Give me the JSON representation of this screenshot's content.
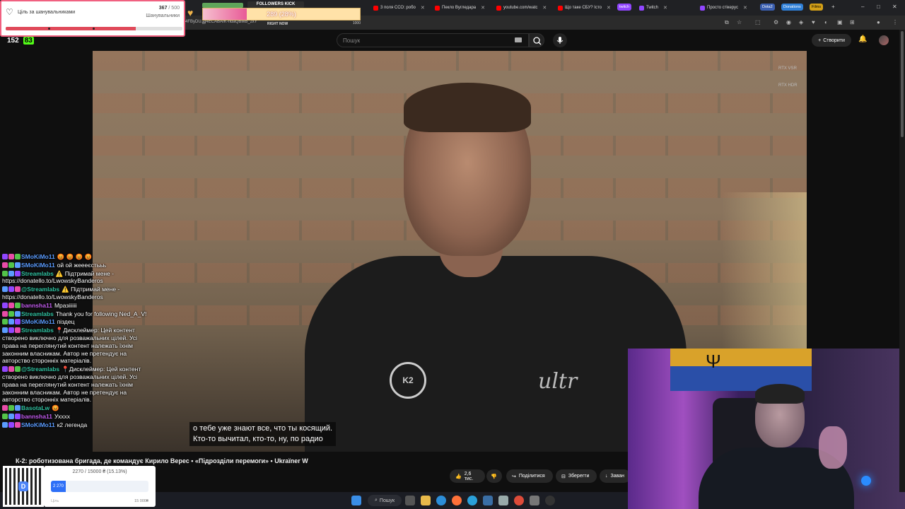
{
  "browser": {
    "tabs": [
      {
        "label": "3 поля ССО: робо"
      },
      {
        "label": "Пекло Вугледара"
      },
      {
        "label": "youtube.com/watc"
      },
      {
        "label": "Що таке СБУ? Істо"
      },
      {
        "label": "Twitch"
      },
      {
        "label": "Просто стікерус"
      }
    ],
    "chips": [
      "twitch",
      "Dota2",
      "Donations",
      "Films"
    ],
    "url": "4FByDU..g4ECABAIK-ndaQBMB_zxY"
  },
  "youtube": {
    "search_placeholder": "Пошук",
    "create_label": "Створити",
    "video_title": "К-2: роботизована бригада, де командує Кирило Верес • «Підрозділи перемоги» • Ukraїner W",
    "subtitle_line1": "о тебе уже знают все, что ты косящий.",
    "subtitle_line2": "Кто-то вычитал, кто-то, ну, по радио",
    "likes": "2,6 тис.",
    "share_label": "Поділитися",
    "save_label": "Зберегти",
    "download_label": "Заван",
    "rtx_vsr": "RTX VSR",
    "rtx_hdr": "RTX HDR",
    "video_logo_k2": "K2",
    "video_logo_ultra": "ultr"
  },
  "follower_goal": {
    "title": "Ціль за шанувальниками",
    "current": "367",
    "target": "/ 500",
    "unit": "Шанувальники",
    "progress": 0.734
  },
  "kick_goal": {
    "title": "FOLLOWERS KICK",
    "value": "289 (28%)",
    "progress": 0.28,
    "start": "0",
    "now_label": "RIGHT NOW",
    "end": "1000"
  },
  "viewers": {
    "total": "152",
    "kick": "83"
  },
  "chat": [
    {
      "user": "SMoKiMo11",
      "color": "#5b9cff",
      "text": "😡 😡 😡 😡"
    },
    {
      "user": "SMoKiMo11",
      "color": "#5b9cff",
      "text": "ой ой жеееєстььь"
    },
    {
      "user": "Streamlabs",
      "color": "#31c3a2",
      "text": "⚠️ Підтримай мене - https://donatello.to/LwowskyBanderos"
    },
    {
      "user": "@Streamlabs",
      "color": "#31c3a2",
      "text": "⚠️ Підтримай мене - https://donatello.to/LwowskyBanderos"
    },
    {
      "user": "bannsha11",
      "color": "#c45cf0",
      "text": "Мразіііііі"
    },
    {
      "user": "Streamlabs",
      "color": "#31c3a2",
      "text": "Thank you for following Ned_A_V!"
    },
    {
      "user": "SMoKiMo11",
      "color": "#5b9cff",
      "text": "піздец"
    },
    {
      "user": "Streamlabs",
      "color": "#31c3a2",
      "text": "📍Дисклеймер: Цей контент створено виключно для розважальних цілей. Усі права на переглянутий контент належать їхнім законним власникам. Автор не претендує на авторство сторонніх матеріалів."
    },
    {
      "user": "@Streamlabs",
      "color": "#31c3a2",
      "text": "📍Дисклеймер: Цей контент створено виключно для розважальних цілей. Усі права на переглянутий контент належать їхнім законним власникам. Автор не претендує на авторство сторонніх матеріалів."
    },
    {
      "user": "BasotaLw",
      "color": "#31c3a2",
      "text": "😡"
    },
    {
      "user": "bannsha11",
      "color": "#c45cf0",
      "text": "Ухххх"
    },
    {
      "user": "SMoKiMo11",
      "color": "#5b9cff",
      "text": "к2 легенда"
    }
  ],
  "donation_goal": {
    "amount_text": "2270 / 15000 ₴ (15.13%)",
    "bar_label": "2 270",
    "progress": 0.1513,
    "goal_label": "Ціль",
    "target_text": "15 000₴",
    "qr_logo": "D"
  },
  "taskbar": {
    "search_label": "Пошук"
  },
  "colors": {
    "youtube_red": "#ff0000",
    "kick_green": "#53fc18",
    "goal_red": "#e04a5a",
    "donatello_blue": "#2d6ff7"
  }
}
